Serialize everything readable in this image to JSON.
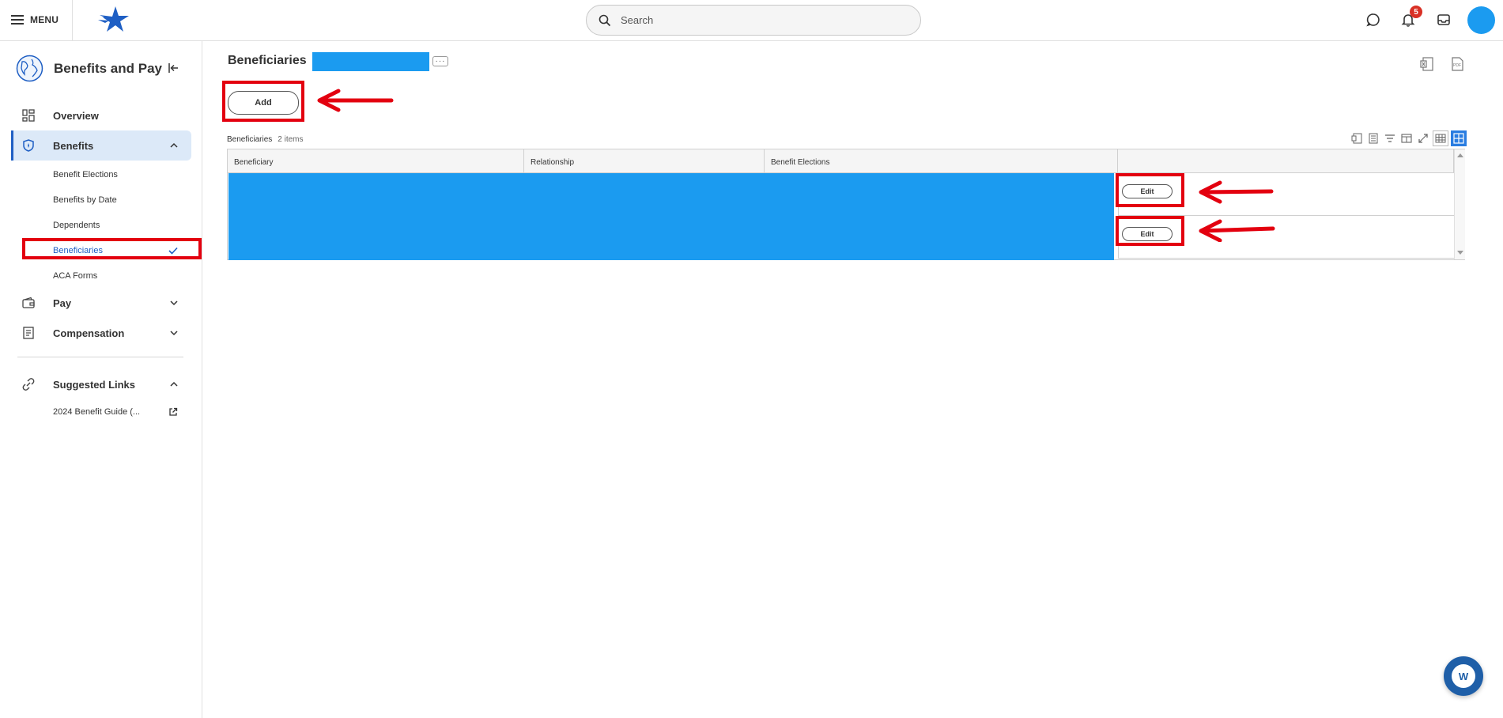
{
  "topbar": {
    "menu_label": "MENU",
    "search_placeholder": "Search",
    "notification_count": "5",
    "brand_color": "#1f5fc4",
    "avatar_color": "#1b9bf0"
  },
  "sidebar": {
    "title": "Benefits and Pay",
    "items": [
      {
        "label": "Overview",
        "icon": "dashboard-icon"
      },
      {
        "label": "Benefits",
        "icon": "shield-icon",
        "expanded": true
      },
      {
        "label": "Pay",
        "icon": "wallet-icon",
        "expanded": false
      },
      {
        "label": "Compensation",
        "icon": "document-icon",
        "expanded": false
      }
    ],
    "benefits_subitems": [
      "Benefit Elections",
      "Benefits by Date",
      "Dependents",
      "Beneficiaries",
      "ACA Forms"
    ],
    "suggested_links": {
      "label": "Suggested Links",
      "icon": "link-icon",
      "links": [
        "2024 Benefit Guide (..."
      ]
    }
  },
  "main": {
    "page_title": "Beneficiaries",
    "add_label": "Add",
    "grid": {
      "caption": "Beneficiaries",
      "count": "2 items",
      "columns": [
        "Beneficiary",
        "Relationship",
        "Benefit Elections"
      ],
      "rows": [
        {
          "action_label": "Edit"
        },
        {
          "action_label": "Edit"
        }
      ]
    }
  },
  "colors": {
    "highlight_red": "#e3000f",
    "redaction_blue": "#1b9bf0",
    "active_nav_bg": "#dce9f8"
  }
}
